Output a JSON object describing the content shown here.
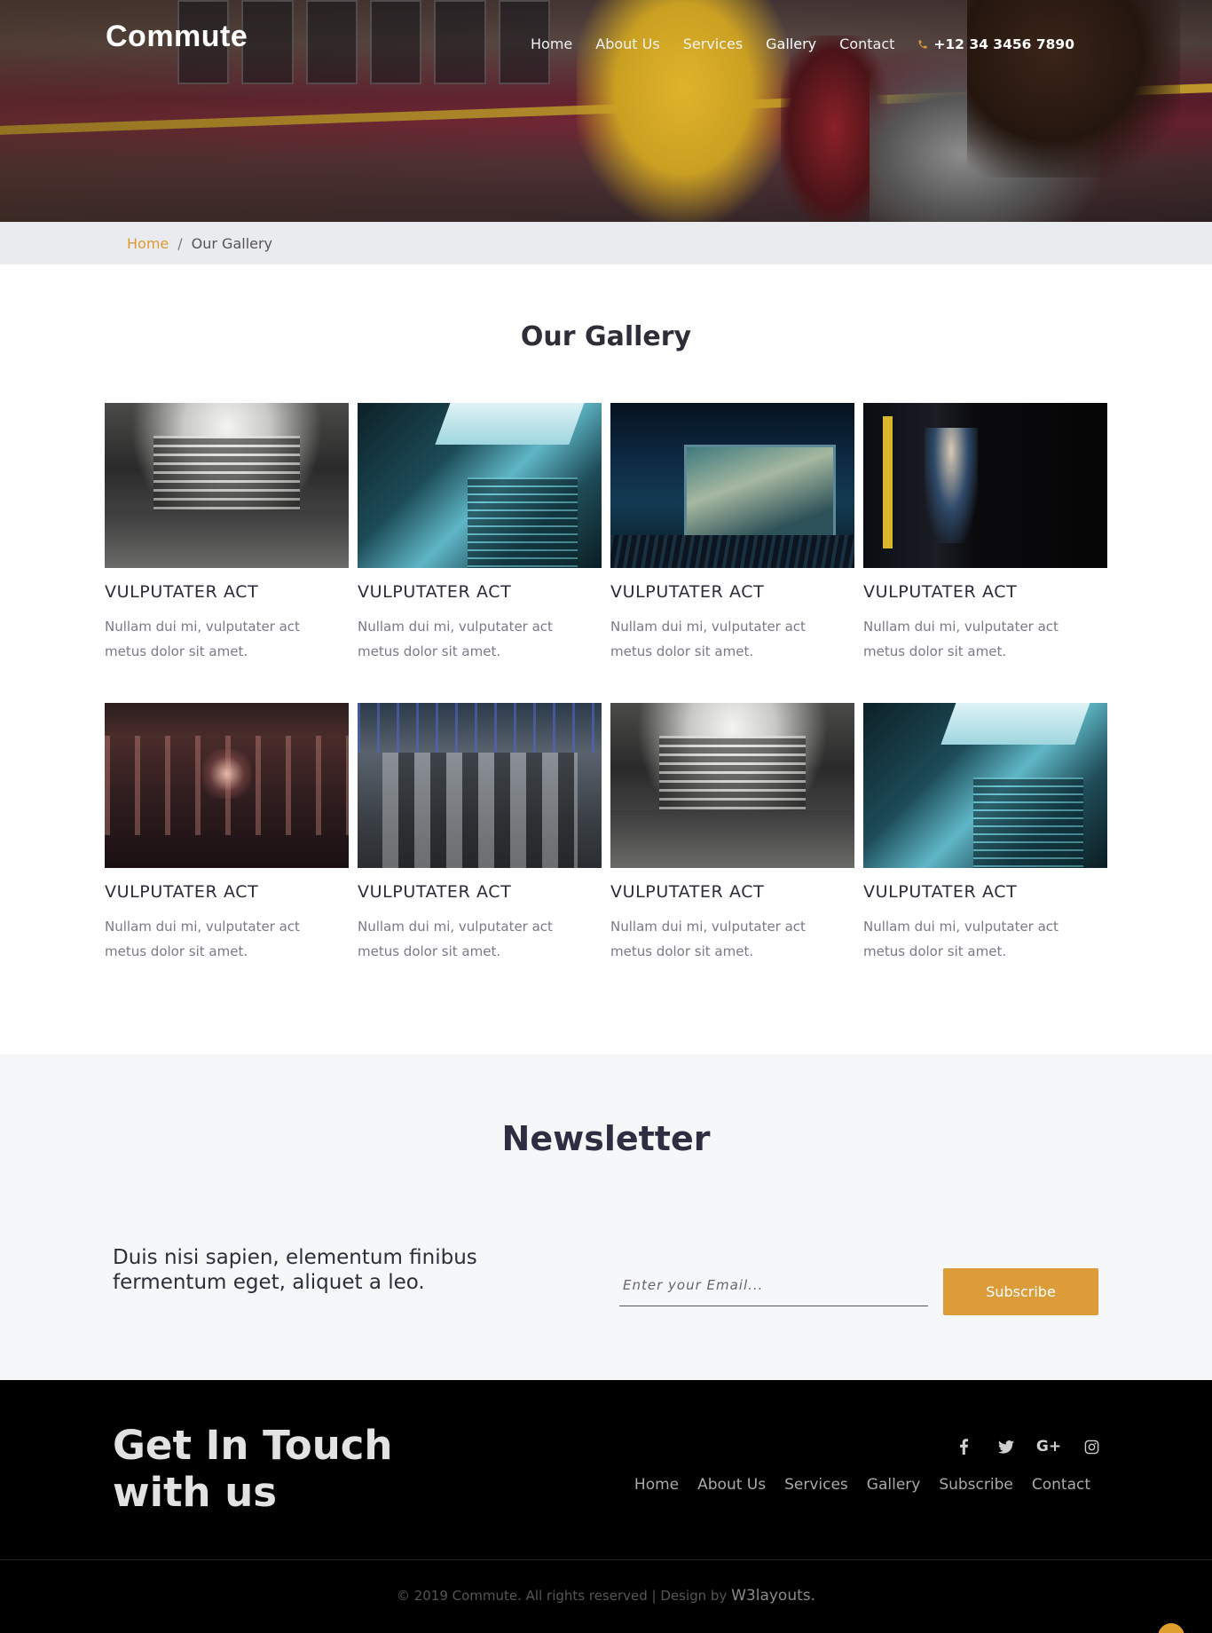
{
  "header": {
    "logo": "Commute",
    "nav": [
      "Home",
      "About Us",
      "Services",
      "Gallery",
      "Contact"
    ],
    "active": "Gallery",
    "phone": "+12 34 3456 7890"
  },
  "breadcrumb": {
    "home": "Home",
    "separator": "/",
    "current": "Our Gallery"
  },
  "gallery": {
    "title": "Our Gallery",
    "items": [
      {
        "title": "VULPUTATER ACT",
        "text": "Nullam dui mi, vulputater act metus dolor sit amet."
      },
      {
        "title": "VULPUTATER ACT",
        "text": "Nullam dui mi, vulputater act metus dolor sit amet."
      },
      {
        "title": "VULPUTATER ACT",
        "text": "Nullam dui mi, vulputater act metus dolor sit amet."
      },
      {
        "title": "VULPUTATER ACT",
        "text": "Nullam dui mi, vulputater act metus dolor sit amet."
      },
      {
        "title": "VULPUTATER ACT",
        "text": "Nullam dui mi, vulputater act metus dolor sit amet."
      },
      {
        "title": "VULPUTATER ACT",
        "text": "Nullam dui mi, vulputater act metus dolor sit amet."
      },
      {
        "title": "VULPUTATER ACT",
        "text": "Nullam dui mi, vulputater act metus dolor sit amet."
      },
      {
        "title": "VULPUTATER ACT",
        "text": "Nullam dui mi, vulputater act metus dolor sit amet."
      }
    ]
  },
  "newsletter": {
    "title": "Newsletter",
    "lead": "Duis nisi sapien, elementum finibus fermentum eget, aliquet a leo.",
    "email_placeholder": "Enter your Email...",
    "button": "Subscribe"
  },
  "footer": {
    "heading": "Get In Touch with us",
    "social": [
      "f",
      "t",
      "G+",
      "ig"
    ],
    "nav": [
      "Home",
      "About Us",
      "Services",
      "Gallery",
      "Subscribe",
      "Contact"
    ],
    "copyright": "© 2019 Commute. All rights reserved | Design by",
    "designer": "W3layouts."
  },
  "colors": {
    "accent": "#dd9c3a",
    "breadcrumb_bg": "#e9ebee",
    "newsletter_bg": "#f6f7f9",
    "footer_bg": "#000000"
  }
}
